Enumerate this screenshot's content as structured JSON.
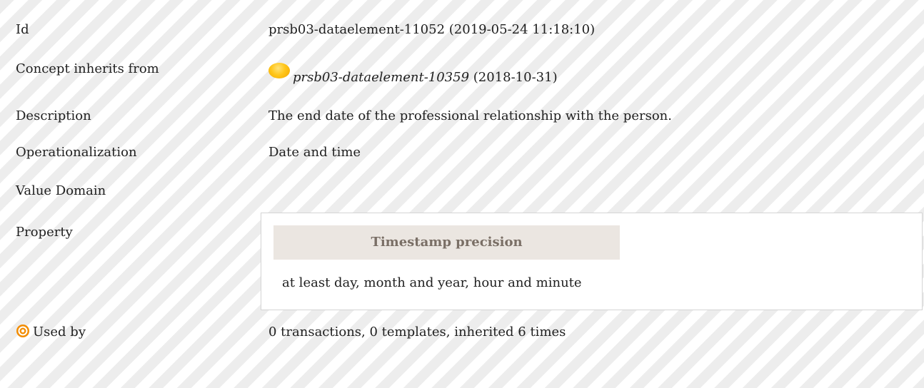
{
  "rows": {
    "id": {
      "label": "Id",
      "value": "prsb03-dataelement-11052 (2019-05-24 11:18:10)"
    },
    "inherits": {
      "label": "Concept inherits from",
      "link": "prsb03-dataelement-10359",
      "date": " (2018-10-31)",
      "status_icon": "yellow-status-dot-icon"
    },
    "description": {
      "label": "Description",
      "value": "The end date of the professional relationship with the person."
    },
    "operationalization": {
      "label": "Operationalization",
      "value": "Date and time"
    },
    "value_domain": {
      "label": "Value Domain"
    },
    "property": {
      "label": "Property",
      "header": "Timestamp precision",
      "value": "at least day, month and year, hour and minute"
    },
    "used_by": {
      "label": "Used by",
      "value": "0 transactions, 0 templates, inherited 6 times",
      "icon": "target-icon"
    }
  },
  "colors": {
    "stripe_light": "#ffffff",
    "stripe_dark": "#ededed",
    "status_yellow": "#ffc61a",
    "target_orange": "#f28c00",
    "property_header_bg": "#ebe6e1",
    "property_header_text": "#7a6f66"
  }
}
